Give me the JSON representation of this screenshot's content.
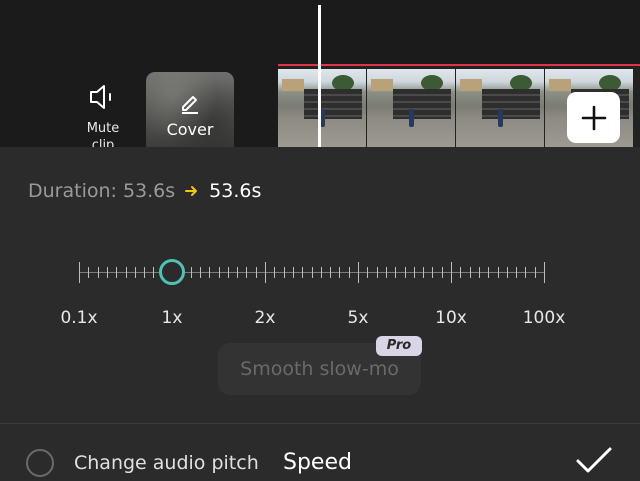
{
  "toolbar": {
    "mute": {
      "label": "Mute\nclip",
      "icon": "speaker-icon"
    },
    "cover": {
      "label": "Cover",
      "icon": "pencil-icon"
    },
    "add_clip": {
      "icon": "plus-icon"
    }
  },
  "duration": {
    "label": "Duration:",
    "from": "53.6s",
    "to": "53.6s",
    "arrow_color": "#f5c518"
  },
  "speed_slider": {
    "labels": [
      "0.1x",
      "1x",
      "2x",
      "5x",
      "10x",
      "100x"
    ],
    "selected_value": "1x",
    "thumb_color": "#4fc2b7"
  },
  "smooth_slowmo": {
    "label": "Smooth slow-mo",
    "badge": "Pro"
  },
  "footer": {
    "audio_pitch_label": "Change audio pitch",
    "audio_pitch_checked": false,
    "title": "Speed",
    "confirm_icon": "checkmark-icon"
  }
}
